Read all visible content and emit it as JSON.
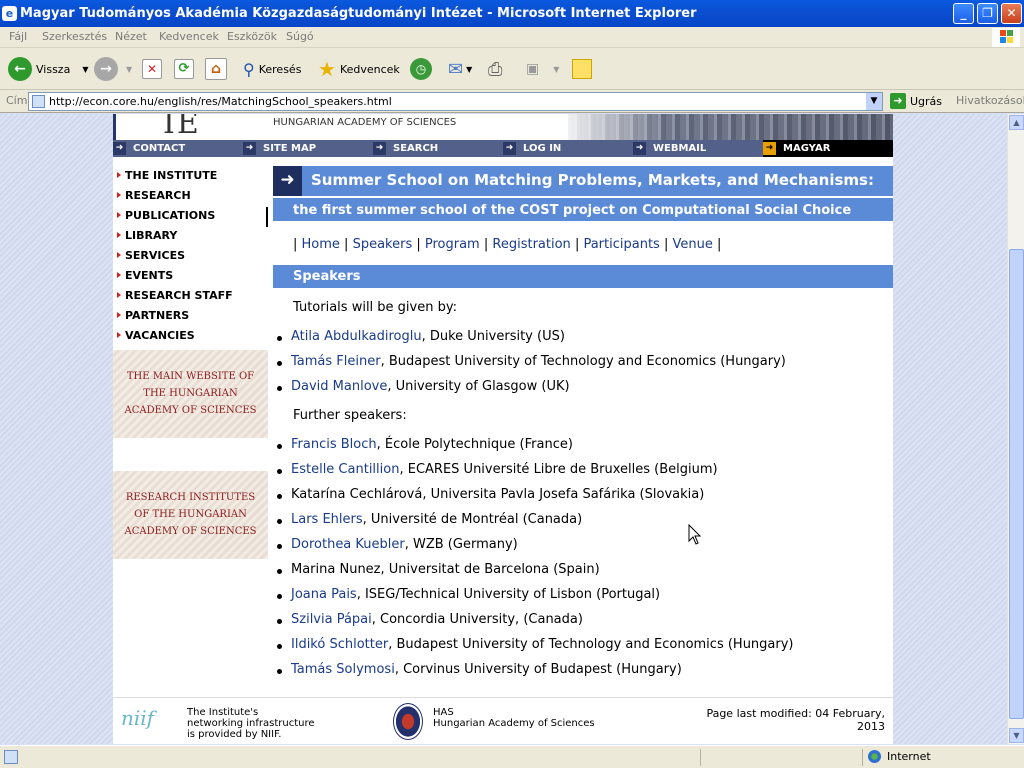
{
  "window": {
    "title": "Magyar Tudományos Akadémia Közgazdaságtudományi Intézet - Microsoft Internet Explorer"
  },
  "menu": [
    "Fájl",
    "Szerkesztés",
    "Nézet",
    "Kedvencek",
    "Eszközök",
    "Súgó"
  ],
  "toolbar": {
    "back": "Vissza",
    "search": "Keresés",
    "favorites": "Kedvencek"
  },
  "address": {
    "label": "Cím",
    "url": "http://econ.core.hu/english/res/MatchingSchool_speakers.html",
    "go": "Ugrás",
    "links": "Hivatkozások"
  },
  "site": {
    "logo": "IE",
    "academy": "HUNGARIAN ACADEMY OF SCIENCES",
    "topnav": [
      "CONTACT",
      "SITE MAP",
      "SEARCH",
      "LOG IN",
      "WEBMAIL",
      "MAGYAR"
    ],
    "sidebar": [
      "THE INSTITUTE",
      "RESEARCH",
      "PUBLICATIONS",
      "LIBRARY",
      "SERVICES",
      "EVENTS",
      "RESEARCH STAFF",
      "PARTNERS",
      "VACANCIES"
    ],
    "ad1": [
      "THE MAIN WEBSITE OF",
      "THE HUNGARIAN",
      "ACADEMY OF SCIENCES"
    ],
    "ad2": [
      "RESEARCH INSTITUTES",
      "OF THE HUNGARIAN",
      "ACADEMY OF SCIENCES"
    ]
  },
  "main": {
    "title": "Summer School on Matching Problems, Markets, and Mechanisms:",
    "subtitle": "the first summer school of the COST project on Computational Social Choice",
    "nav": [
      "Home",
      "Speakers",
      "Program",
      "Registration",
      "Participants",
      "Venue"
    ],
    "section": "Speakers",
    "tutorials_intro": "Tutorials will be given by:",
    "tutorials": [
      {
        "name": "Atila Abdulkadiroglu",
        "affil": ", Duke University (US)"
      },
      {
        "name": "Tamás Fleiner",
        "affil": ", Budapest University of Technology and Economics (Hungary)"
      },
      {
        "name": "David Manlove",
        "affil": ", University of Glasgow (UK)"
      }
    ],
    "further_intro": "Further speakers:",
    "further": [
      {
        "name": "Francis Bloch",
        "affil": ", École Polytechnique (France)"
      },
      {
        "name": "Estelle Cantillion",
        "affil": ", ECARES Université Libre de Bruxelles (Belgium)"
      },
      {
        "name": "Katarína Cechlárová, Universita Pavla Josefa Safárika (Slovakia)",
        "affil": ""
      },
      {
        "name": "Lars Ehlers",
        "affil": ", Université de Montréal (Canada)"
      },
      {
        "name": "Dorothea Kuebler",
        "affil": ", WZB (Germany)"
      },
      {
        "name": "Marina Nunez, Universitat de Barcelona (Spain)",
        "affil": ""
      },
      {
        "name": "Joana Pais",
        "affil": ", ISEG/Technical University of Lisbon (Portugal)"
      },
      {
        "name": "Szilvia Pápai",
        "affil": ", Concordia University, (Canada)"
      },
      {
        "name": "Ildikó Schlotter",
        "affil": ", Budapest University of Technology and Economics (Hungary)"
      },
      {
        "name": "Tamás Solymosi",
        "affil": ", Corvinus University of Budapest (Hungary)"
      }
    ]
  },
  "footer": {
    "niif_logo": "niif",
    "niif_text": [
      "The Institute's",
      "networking infrastructure",
      "is provided by NIIF."
    ],
    "has_text": [
      "HAS",
      "Hungarian Academy of Sciences"
    ],
    "modified": [
      "Page last modified: 04 February,",
      "2013"
    ]
  },
  "status": {
    "zone": "Internet"
  }
}
